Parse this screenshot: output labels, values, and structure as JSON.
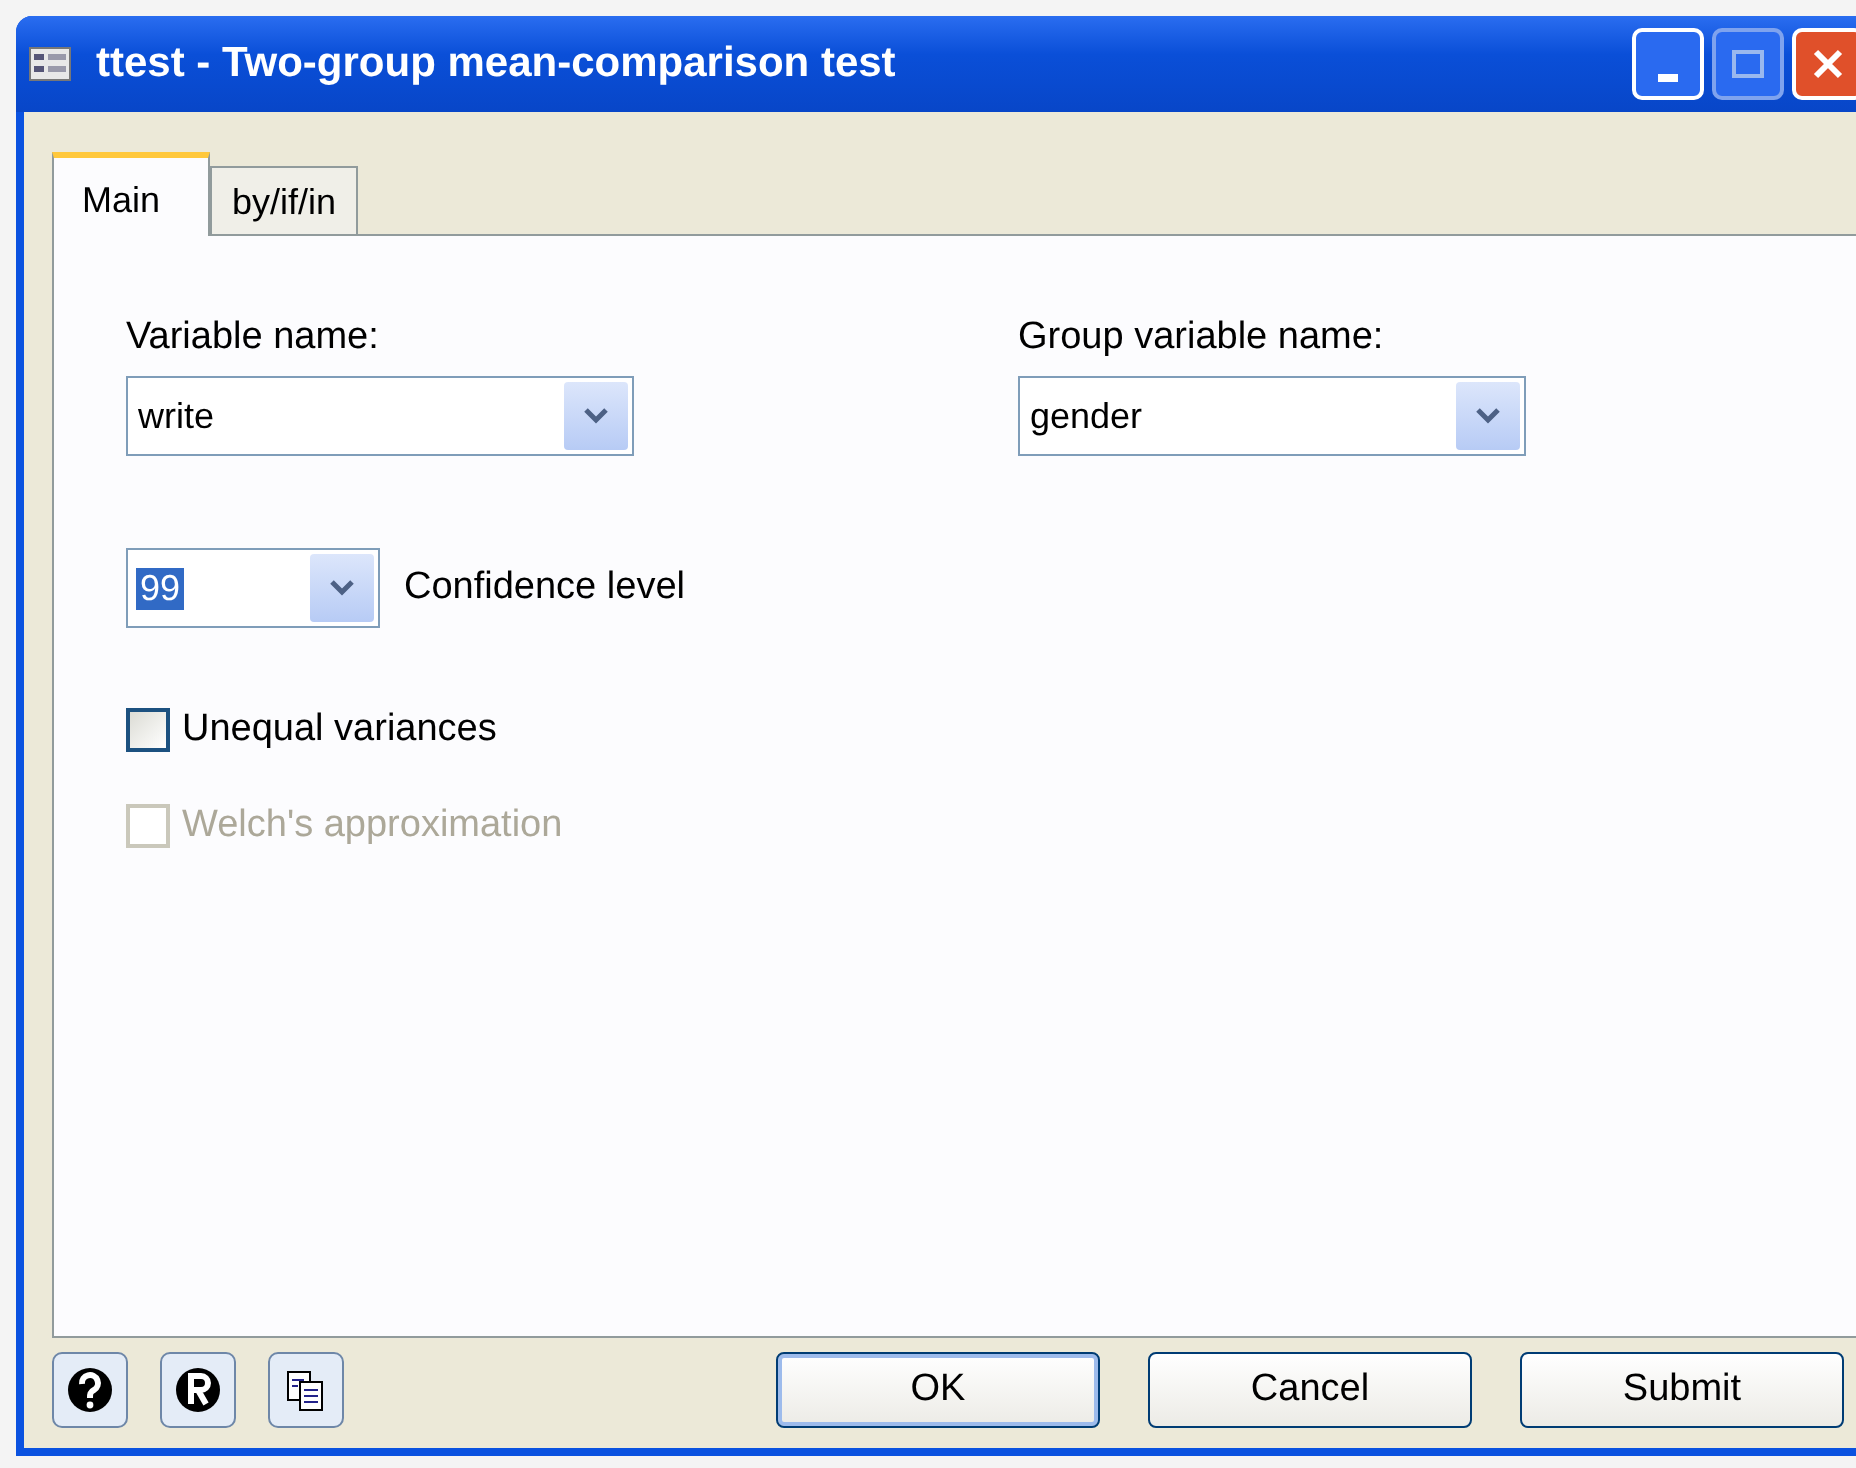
{
  "window": {
    "title": "ttest - Two-group mean-comparison test"
  },
  "tabs": [
    {
      "label": "Main",
      "selected": true
    },
    {
      "label": "by/if/in",
      "selected": false
    }
  ],
  "variable": {
    "label": "Variable name:",
    "value": "write"
  },
  "group_variable": {
    "label": "Group variable name:",
    "value": "gender"
  },
  "confidence": {
    "value": "99",
    "text_selected": true,
    "label": "Confidence level"
  },
  "options": [
    {
      "label": "Unequal variances",
      "checked": false,
      "disabled": false
    },
    {
      "label": "Welch's approximation",
      "checked": false,
      "disabled": true
    }
  ],
  "buttons": [
    {
      "label": "OK",
      "default": true
    },
    {
      "label": "Cancel",
      "default": false
    },
    {
      "label": "Submit",
      "default": false
    }
  ]
}
